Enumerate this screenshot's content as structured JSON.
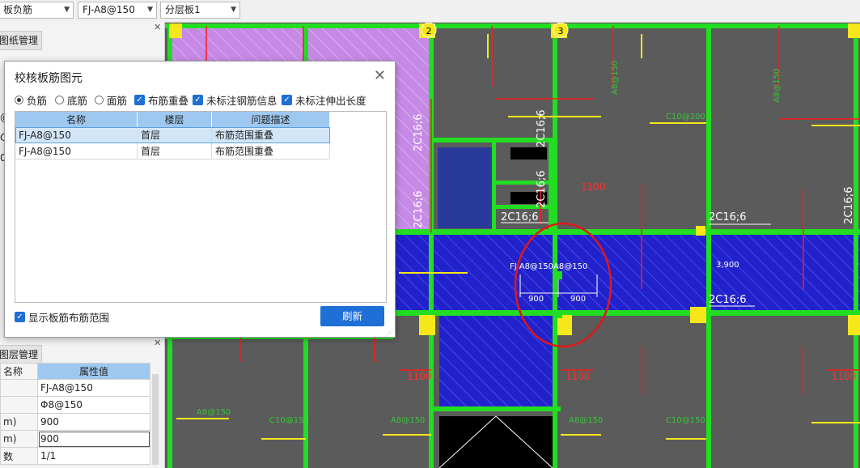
{
  "toolbar": {
    "combo1": "板负筋",
    "combo2": "FJ-A8@150",
    "combo3": "分层板1"
  },
  "left_panel": {
    "drawing_tab": "图纸管理",
    "row_labels": [
      "@",
      "C",
      "0"
    ],
    "layer_tab": "图层管理",
    "prop_header_name": "名称",
    "prop_header_value": "属性值",
    "properties": [
      {
        "name": "",
        "value": "FJ-A8@150"
      },
      {
        "name": "",
        "value": "Φ8@150"
      },
      {
        "name": "m)",
        "value": "900"
      },
      {
        "name": "m)",
        "value": "900"
      },
      {
        "name": "数",
        "value": "1/1"
      }
    ]
  },
  "dialog": {
    "title": "校核板筋图元",
    "options": {
      "neg": "负筋",
      "bottom": "底筋",
      "face": "面筋",
      "overlap": "布筋重叠",
      "unlabeled_info": "未标注钢筋信息",
      "unlabeled_len": "未标注伸出长度"
    },
    "table": {
      "headers": [
        "名称",
        "楼层",
        "问题描述"
      ],
      "rows": [
        [
          "FJ-A8@150",
          "首层",
          "布筋范围重叠"
        ],
        [
          "FJ-A8@150",
          "首层",
          "布筋范围重叠"
        ]
      ]
    },
    "show_range": "显示板筋布筋范围",
    "refresh": "刷新"
  },
  "cad": {
    "labels": {
      "c1": "2C16;6",
      "c2": "2C16;6",
      "c3": "2C16;6",
      "c4": "2C16;6",
      "c5": "2C16;6",
      "c6": "2C16;6",
      "c7": "2C16;6",
      "fj": "FJ-A8@150A8@150",
      "d900a": "900",
      "d900b": "900",
      "d3900": "3,900",
      "d1100a": "1100",
      "d1100b": "1100",
      "d1100c": "1100",
      "d1100d": "1100",
      "ax2": "2",
      "ax3": "3"
    }
  },
  "colors": {
    "accent": "#1e6fd6",
    "header_blue": "#9ec8f0",
    "wall_green": "#22dd22",
    "slab_blue": "#2222cc",
    "purple": "#c68ae6"
  }
}
